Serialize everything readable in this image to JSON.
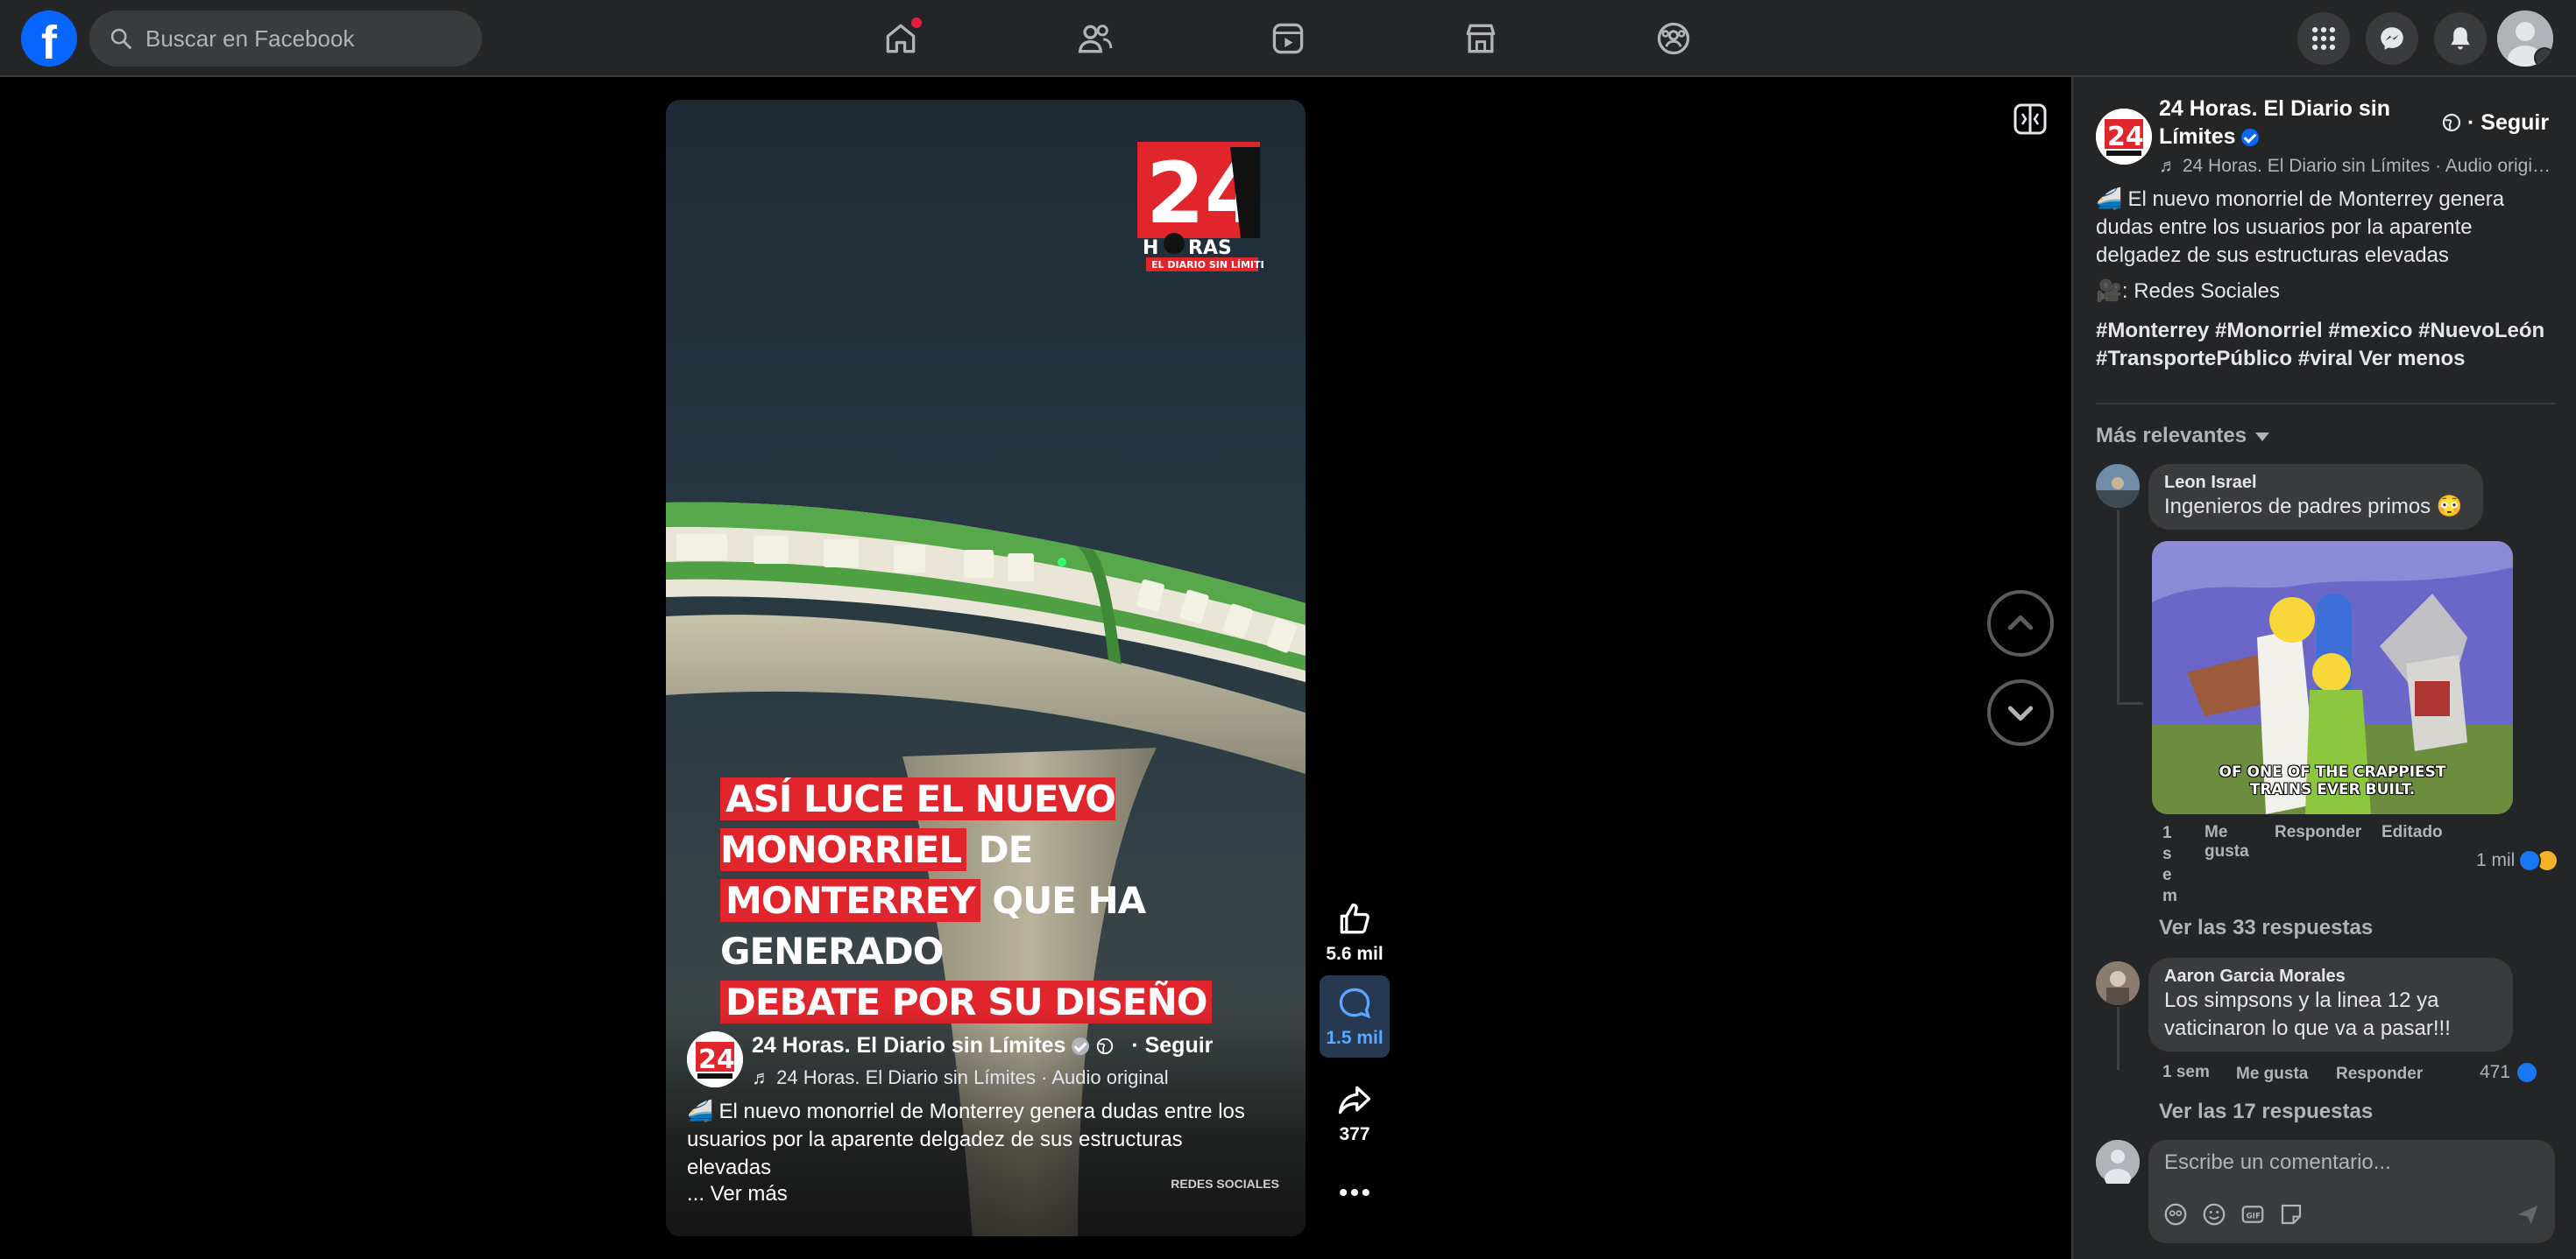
{
  "header": {
    "search_placeholder": "Buscar en Facebook"
  },
  "video": {
    "headline": [
      {
        "hl": "ASÍ LUCE EL NUEVO MONORRIEL",
        "rest": " DE"
      },
      {
        "hl": "MONTERREY",
        "rest": " QUE HA GENERADO"
      },
      {
        "hl": "DEBATE POR SU DISEÑO",
        "rest": ""
      }
    ],
    "author": "24 Horas. El Diario sin Límites",
    "follow": "· Seguir",
    "audio": "♬ 24 Horas. El Diario sin Límites · Audio original",
    "caption": "🚄 El nuevo monorriel de Monterrey genera dudas entre los usuarios por la aparente delgadez de sus estructuras elevadas",
    "see_more": "... Ver más",
    "credit": "REDES SOCIALES",
    "logo_sub": "EL DIARIO SIN LÍMITES",
    "logo_word": "HORAS",
    "logo_num": "24"
  },
  "actions": {
    "likes": "5.6 mil",
    "comments": "1.5 mil",
    "shares": "377"
  },
  "panel": {
    "author_line1": "24 Horas. El Diario sin",
    "author_line2": "Límites",
    "follow": "· Seguir",
    "audio": "♬ 24 Horas. El Diario sin Límites · Audio original",
    "caption": "🚄 El nuevo monorriel de Monterrey genera dudas entre los usuarios por la aparente delgadez de sus estructuras elevadas",
    "source": "🎥: Redes Sociales",
    "tags": "#Monterrey #Monorriel #mexico #NuevoLeón #TransportePúblico #viral",
    "see_less": "Ver menos",
    "sort": "Más relevantes"
  },
  "comments": [
    {
      "name": "Leon Israel",
      "text": "Ingenieros de padres primos 😳",
      "gif_caption": "OF ONE OF THE CRAPPIEST TRAINS EVER BUILT.",
      "time": "1 sem",
      "like": "Me gusta",
      "reply": "Responder",
      "edited": "Editado",
      "reactions": "1 mil",
      "replies": "Ver las 33 respuestas"
    },
    {
      "name": "Aaron Garcia Morales",
      "text": "Los simpsons y la linea 12 ya vaticinaron lo que va a pasar!!!",
      "time": "1 sem",
      "like": "Me gusta",
      "reply": "Responder",
      "reactions": "471",
      "replies": "Ver las 17 respuestas"
    }
  ],
  "composer": {
    "placeholder": "Escribe un comentario..."
  },
  "colors": {
    "brand": "#0866ff",
    "headline_highlight": "#e0262c",
    "monorail_green": "#4caf50"
  }
}
